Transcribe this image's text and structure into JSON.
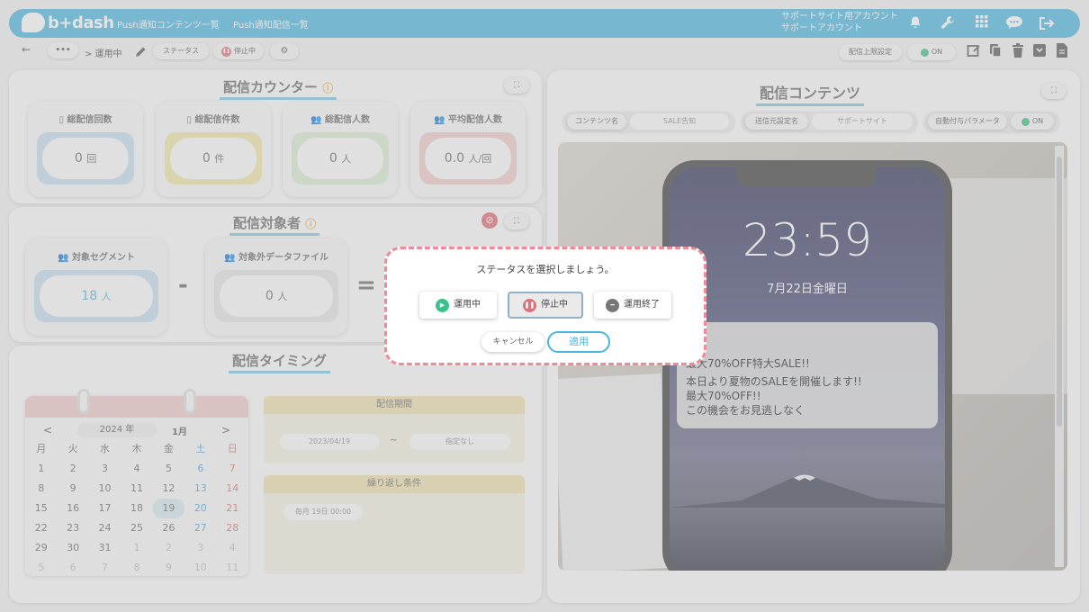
{
  "header": {
    "logo": "b+dash",
    "nav": [
      "Push通知コンテンツ一覧",
      "Push通知配信一覧"
    ],
    "account_line1": "サポートサイト用アカウント",
    "account_line2": "サポートアカウント",
    "icons": [
      "bell-icon",
      "wrench-icon",
      "grid-icon",
      "chat-icon",
      "logout-icon"
    ]
  },
  "toolbar": {
    "back": "←",
    "more": "•••",
    "crumb": "> 運用中",
    "status_label": "ステータス",
    "status_value": "停止中",
    "limit_label": "配信上限設定",
    "limit_toggle": "ON"
  },
  "counter": {
    "title": "配信カウンター",
    "cards": [
      {
        "label": "総配信回数",
        "value": "0",
        "unit": "回"
      },
      {
        "label": "総配信件数",
        "value": "0",
        "unit": "件"
      },
      {
        "label": "総配信人数",
        "value": "0",
        "unit": "人"
      },
      {
        "label": "平均配信人数",
        "value": "0.0",
        "unit": "人/回"
      }
    ]
  },
  "target": {
    "title": "配信対象者",
    "segment_label": "対象セグメント",
    "segment_value": "18",
    "segment_unit": "人",
    "minus": "-",
    "exclude_label": "対象外データファイル",
    "exclude_value": "0",
    "exclude_unit": "人",
    "equals": "="
  },
  "timing": {
    "title": "配信タイミング",
    "calendar": {
      "year": "2024 年",
      "month": "1月",
      "prev": "<",
      "next": ">",
      "weekdays": [
        "月",
        "火",
        "水",
        "木",
        "金",
        "土",
        "日"
      ],
      "weeks": [
        [
          "1",
          "2",
          "3",
          "4",
          "5",
          "6",
          "7"
        ],
        [
          "8",
          "9",
          "10",
          "11",
          "12",
          "13",
          "14"
        ],
        [
          "15",
          "16",
          "17",
          "18",
          "19",
          "20",
          "21"
        ],
        [
          "22",
          "23",
          "24",
          "25",
          "26",
          "27",
          "28"
        ],
        [
          "29",
          "30",
          "31",
          "1",
          "2",
          "3",
          "4"
        ],
        [
          "5",
          "6",
          "7",
          "8",
          "9",
          "10",
          "11"
        ]
      ],
      "selected": "19"
    },
    "period_label": "配信期間",
    "period_start": "2023/04/19",
    "period_sep": "~",
    "period_end": "指定なし",
    "repeat_label": "繰り返し条件",
    "repeat_value": "毎月 19日 00:00"
  },
  "content": {
    "title": "配信コンテンツ",
    "name_label": "コンテンツ名",
    "name_value": "SALE告知",
    "sender_label": "送信元設定名",
    "sender_value": "サポートサイト",
    "param_label": "自動付与パラメータ",
    "param_toggle": "ON",
    "phone_time": "23:59",
    "phone_date": "7月22日金曜日",
    "notif_title": "最大70%OFF特大SALE!!",
    "notif_body1": "本日より夏物のSALEを開催します!!",
    "notif_body2": "最大70%OFF!!",
    "notif_body3": "この機会をお見逃しなく"
  },
  "modal": {
    "prompt": "ステータスを選択しましょう。",
    "opt_running": "運用中",
    "opt_stopped": "停止中",
    "opt_ended": "運用終了",
    "cancel": "キャンセル",
    "apply": "適用"
  },
  "colors": {
    "accent": "#49b6e0",
    "modal_border": "#f08a98",
    "running": "#3cc08a",
    "stopped": "#e0707a",
    "ended": "#777777"
  }
}
